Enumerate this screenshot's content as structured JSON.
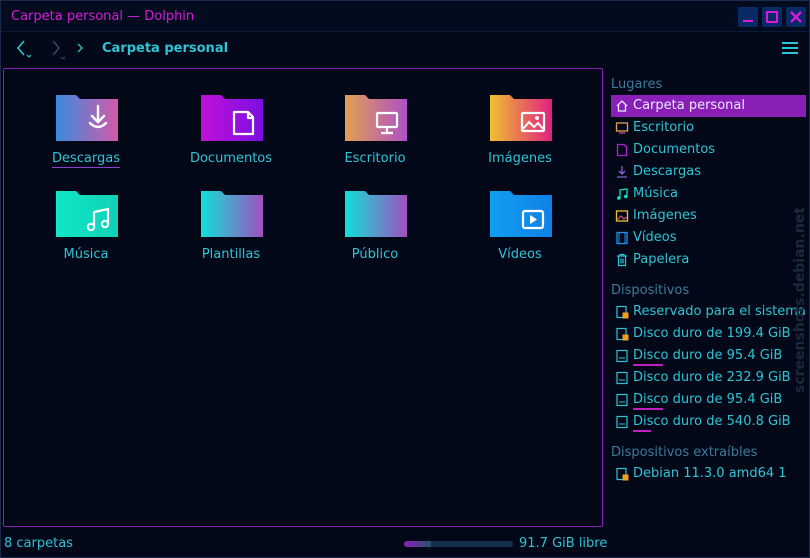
{
  "window": {
    "title": "Carpeta personal — Dolphin"
  },
  "toolbar": {
    "breadcrumb": "Carpeta personal"
  },
  "files": [
    {
      "name": "Descargas",
      "icon": "download-folder-icon",
      "current": true
    },
    {
      "name": "Documentos",
      "icon": "documents-folder-icon"
    },
    {
      "name": "Escritorio",
      "icon": "desktop-folder-icon"
    },
    {
      "name": "Imágenes",
      "icon": "pictures-folder-icon"
    },
    {
      "name": "Música",
      "icon": "music-folder-icon"
    },
    {
      "name": "Plantillas",
      "icon": "templates-folder-icon"
    },
    {
      "name": "Público",
      "icon": "public-folder-icon"
    },
    {
      "name": "Vídeos",
      "icon": "videos-folder-icon"
    }
  ],
  "places": {
    "headings": {
      "places": "Lugares",
      "devices": "Dispositivos",
      "removable": "Dispositivos extraíbles"
    },
    "places_items": [
      {
        "label": "Carpeta personal",
        "icon": "home-icon",
        "active": true
      },
      {
        "label": "Escritorio",
        "icon": "desktop-icon"
      },
      {
        "label": "Documentos",
        "icon": "documents-icon"
      },
      {
        "label": "Descargas",
        "icon": "download-icon"
      },
      {
        "label": "Música",
        "icon": "music-icon"
      },
      {
        "label": "Imágenes",
        "icon": "image-icon"
      },
      {
        "label": "Vídeos",
        "icon": "video-icon"
      },
      {
        "label": "Papelera",
        "icon": "trash-icon"
      }
    ],
    "device_items": [
      {
        "label": "Reservado para el sistema",
        "icon": "drive-locked-icon"
      },
      {
        "label": "Disco duro de 199.4 GiB",
        "icon": "drive-locked-icon"
      },
      {
        "label": "Disco duro de 95.4 GiB",
        "icon": "drive-icon",
        "usage": 0.2
      },
      {
        "label": "Disco duro de 232.9 GiB",
        "icon": "drive-icon"
      },
      {
        "label": "Disco duro de 95.4 GiB",
        "icon": "drive-icon",
        "usage": 0.2
      },
      {
        "label": "Disco duro de 540.8 GiB",
        "icon": "drive-icon",
        "usage": 0.12
      }
    ],
    "removable_items": [
      {
        "label": "Debian 11.3.0 amd64 1",
        "icon": "optical-locked-icon"
      }
    ]
  },
  "status": {
    "summary": "8 carpetas",
    "free_space": "91.7 GiB libre",
    "used_fraction": 0.25
  },
  "watermark": {
    "text": "screenshots.debian.net"
  },
  "colors": {
    "accent": "#8a1fb8",
    "text": "#2ec4d4",
    "title": "#d81bd8",
    "background": "#020818"
  }
}
